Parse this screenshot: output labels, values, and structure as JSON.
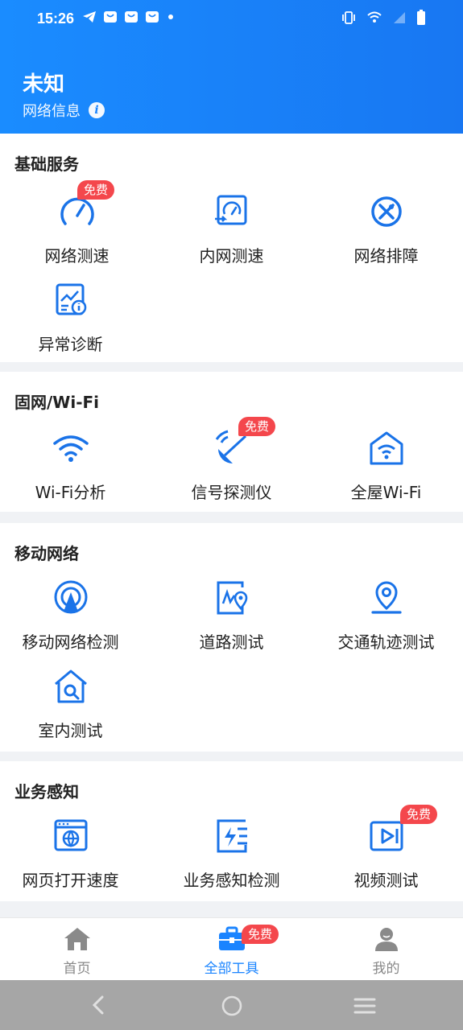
{
  "status": {
    "time": "15:26"
  },
  "header": {
    "title": "未知",
    "subtitle": "网络信息"
  },
  "badge_free": "免费",
  "sections": [
    {
      "title": "基础服务",
      "items": [
        {
          "label": "网络测速",
          "icon": "speedometer-icon",
          "badge": true
        },
        {
          "label": "内网测速",
          "icon": "intranet-speed-icon",
          "badge": false
        },
        {
          "label": "网络排障",
          "icon": "tools-icon",
          "badge": false
        },
        {
          "label": "异常诊断",
          "icon": "diagnosis-icon",
          "badge": false
        }
      ]
    },
    {
      "title": "固网/Wi-Fi",
      "items": [
        {
          "label": "Wi-Fi分析",
          "icon": "wifi-icon",
          "badge": false
        },
        {
          "label": "信号探测仪",
          "icon": "signal-detector-icon",
          "badge": true
        },
        {
          "label": "全屋Wi-Fi",
          "icon": "house-wifi-icon",
          "badge": false
        }
      ]
    },
    {
      "title": "移动网络",
      "items": [
        {
          "label": "移动网络检测",
          "icon": "cell-tower-icon",
          "badge": false
        },
        {
          "label": "道路测试",
          "icon": "road-test-icon",
          "badge": false
        },
        {
          "label": "交通轨迹测试",
          "icon": "location-pin-icon",
          "badge": false
        },
        {
          "label": "室内测试",
          "icon": "indoor-search-icon",
          "badge": false
        }
      ]
    },
    {
      "title": "业务感知",
      "items": [
        {
          "label": "网页打开速度",
          "icon": "webpage-icon",
          "badge": false
        },
        {
          "label": "业务感知检测",
          "icon": "service-detect-icon",
          "badge": false
        },
        {
          "label": "视频测试",
          "icon": "video-icon",
          "badge": true
        }
      ]
    }
  ],
  "bottom_nav": [
    {
      "label": "首页",
      "icon": "home-icon",
      "active": false
    },
    {
      "label": "全部工具",
      "icon": "toolbox-icon",
      "active": true
    },
    {
      "label": "我的",
      "icon": "profile-icon",
      "active": false
    }
  ],
  "colors": {
    "primary": "#1a84ff",
    "badge": "#f4474c",
    "icon": "#1a73e8"
  }
}
